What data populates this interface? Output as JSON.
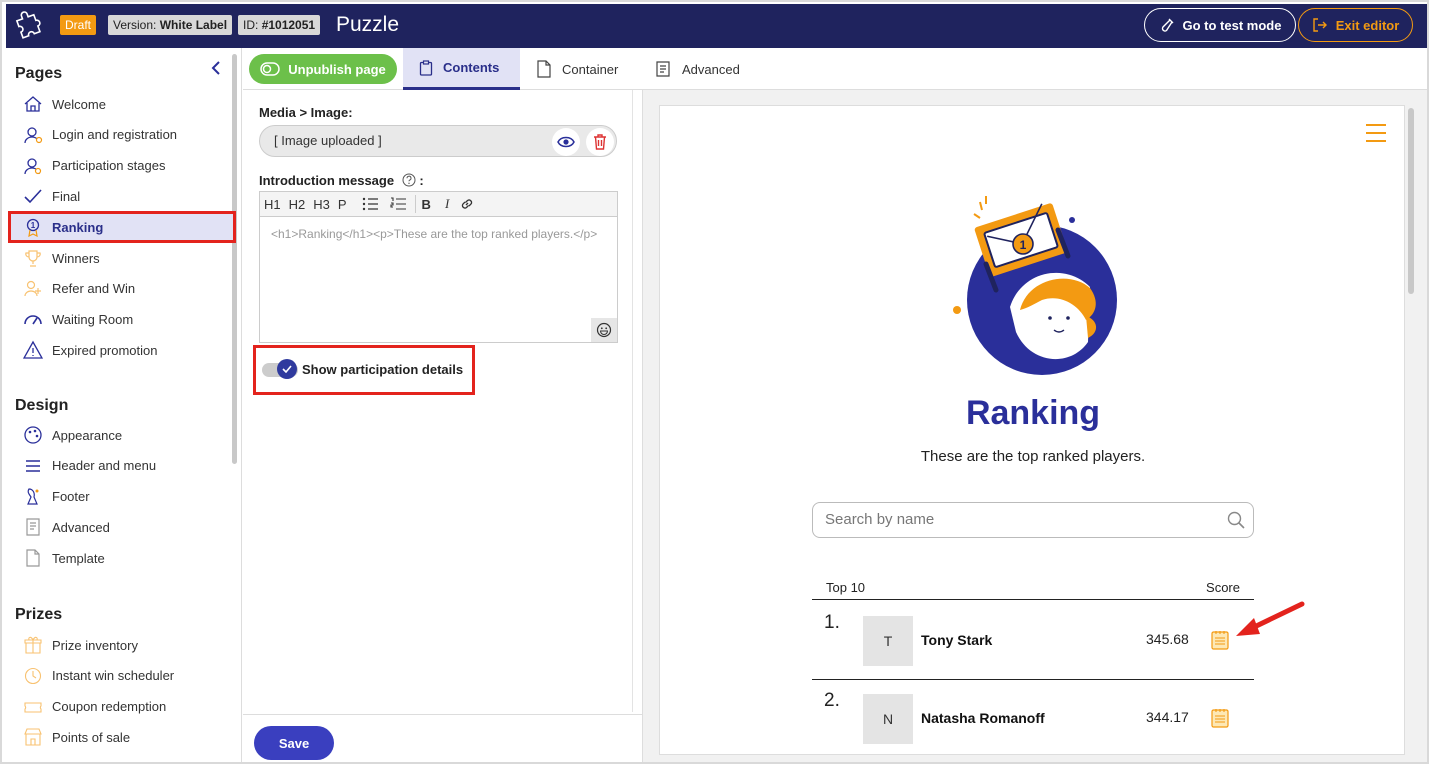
{
  "header": {
    "status_badge": "Draft",
    "version_label": "Version:",
    "version_value": "White Label",
    "id_label": "ID:",
    "id_value": "#1012051",
    "app_title": "Puzzle",
    "test_mode_label": "Go to test mode",
    "exit_label": "Exit editor"
  },
  "sidebar": {
    "pages_title": "Pages",
    "pages": [
      {
        "label": "Welcome",
        "icon": "home-icon"
      },
      {
        "label": "Login and registration",
        "icon": "user-icon"
      },
      {
        "label": "Participation stages",
        "icon": "user-settings-icon"
      },
      {
        "label": "Final",
        "icon": "check-icon"
      },
      {
        "label": "Ranking",
        "icon": "medal-icon",
        "active": true
      },
      {
        "label": "Winners",
        "icon": "trophy-icon"
      },
      {
        "label": "Refer and Win",
        "icon": "refer-icon"
      },
      {
        "label": "Waiting Room",
        "icon": "gauge-icon"
      },
      {
        "label": "Expired promotion",
        "icon": "warning-icon"
      }
    ],
    "design_title": "Design",
    "design": [
      {
        "label": "Appearance",
        "icon": "palette-icon"
      },
      {
        "label": "Header and menu",
        "icon": "menu-icon"
      },
      {
        "label": "Footer",
        "icon": "footer-icon"
      },
      {
        "label": "Advanced",
        "icon": "document-icon"
      },
      {
        "label": "Template",
        "icon": "page-icon"
      }
    ],
    "prizes_title": "Prizes",
    "prizes": [
      {
        "label": "Prize inventory",
        "icon": "gift-icon"
      },
      {
        "label": "Instant win scheduler",
        "icon": "clock-icon"
      },
      {
        "label": "Coupon redemption",
        "icon": "coupon-icon"
      },
      {
        "label": "Points of sale",
        "icon": "store-icon"
      }
    ]
  },
  "tabs": {
    "unpublish_label": "Unpublish page",
    "contents_label": "Contents",
    "container_label": "Container",
    "advanced_label": "Advanced"
  },
  "editor": {
    "media_label": "Media > Image:",
    "image_value": "[ Image uploaded ]",
    "intro_label": "Introduction message",
    "intro_colon": ":",
    "toolbar": [
      "H1",
      "H2",
      "H3",
      "P"
    ],
    "bold": "B",
    "italic": "I",
    "intro_html": "<h1>Ranking</h1><p>These are the top ranked players.</p>",
    "show_details_label": "Show participation details",
    "save_label": "Save"
  },
  "preview": {
    "title": "Ranking",
    "subtitle": "These are the top ranked players.",
    "search_placeholder": "Search by name",
    "col_top": "Top 10",
    "col_score": "Score",
    "rows": [
      {
        "rank": "1.",
        "initial": "T",
        "name": "Tony Stark",
        "score": "345.68"
      },
      {
        "rank": "2.",
        "initial": "N",
        "name": "Natasha Romanoff",
        "score": "344.17"
      }
    ]
  },
  "colors": {
    "navy": "#1f235e",
    "accent": "#2a2f9a",
    "orange": "#f39a12",
    "green": "#6cc04a",
    "highlight": "#e3231d"
  }
}
